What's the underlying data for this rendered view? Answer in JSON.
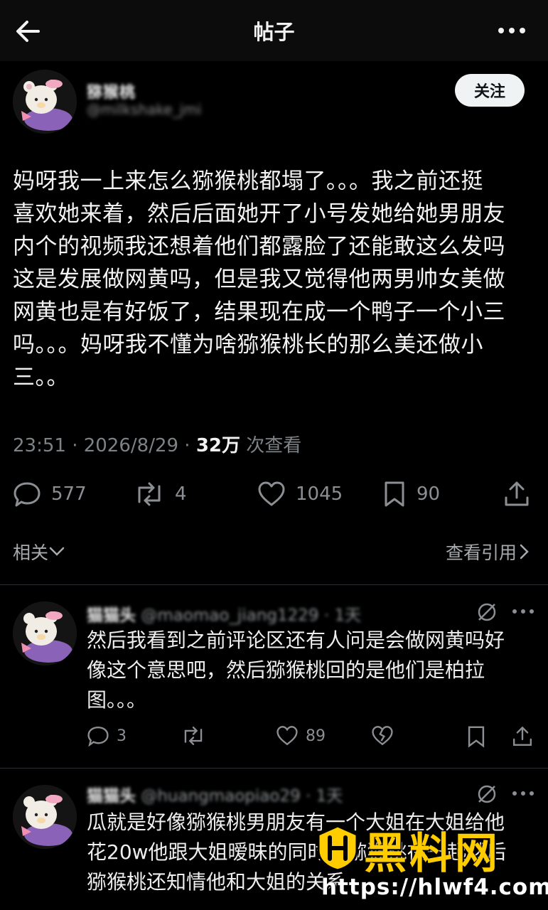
{
  "header": {
    "title": "帖子",
    "back_icon": "arrow-left-icon",
    "more_icon": "more-dots-icon"
  },
  "post": {
    "author_name": "猕猴桃",
    "author_handle": "@milkshake_jmi",
    "follow_label": "关注",
    "text": "妈呀我一上来怎么猕猴桃都塌了。。。我之前还挺\n喜欢她来着，然后后面她开了小号发她给她男朋友\n内个的视频我还想着他们都露脸了还能敢这么发吗\n这是发展做网黄吗，但是我又觉得他两男帅女美做\n网黄也是有好饭了，结果现在成一个鸭子一个小三\n吗。。。妈呀我不懂为啥猕猴桃长的那么美还做小\n三。。",
    "time": "23:51 · 2026/8/29 · ",
    "views": "32万",
    "views_label": " 次查看",
    "stats": {
      "replies": "577",
      "reposts": "4",
      "likes": "1045",
      "bookmarks": "90"
    }
  },
  "related_label": "相关",
  "quotes_label": "查看引用",
  "comments": [
    {
      "name": "猫猫头",
      "handle": "@maomao_jiang1229 · 1天",
      "text": "然后我看到之前评论区还有人问是会做网黄吗好\n像这个意思吧，然后猕猴桃回的是他们是柏拉\n图。。。",
      "replies": "3",
      "likes": "89"
    },
    {
      "name": "猫猫头",
      "handle": "@huangmaopiao29 · 1天",
      "text": "瓜就是好像猕猴桃男朋友有一个大姐在大姐给他\n花20w他跟大姐暧昧的同时跟猕猴桃在一起然后\n猕猴桃还知情他和大姐的关系"
    }
  ],
  "watermark": {
    "title": "黑料网",
    "url": "https://hlwf4.com"
  },
  "colors": {
    "background": "#000000",
    "text": "#e7e9ea",
    "muted": "#8b8f93",
    "watermark": "#ffcc00"
  }
}
